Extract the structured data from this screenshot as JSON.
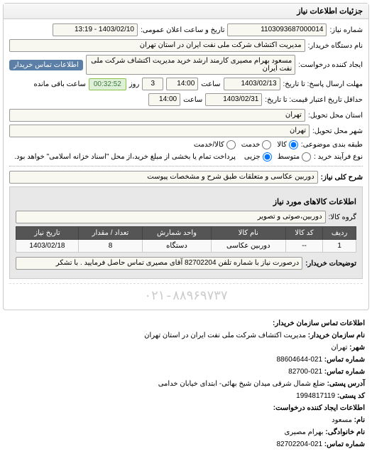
{
  "panel_title": "جزئیات اطلاعات نیاز",
  "labels": {
    "need_no": "شماره نیاز:",
    "announce_dt": "تاریخ و ساعت اعلان عمومی:",
    "buyer_name": "نام دستگاه خریدار:",
    "requester": "ایجاد کننده درخواست:",
    "buyer_contact_btn": "اطلاعات تماس خریدار",
    "reply_deadline": "مهلت ارسال پاسخ: تا تاریخ:",
    "time": "ساعت",
    "day": "روز",
    "remaining": "ساعت باقی مانده",
    "validity": "حداقل تاریخ اعتبار قیمت: تا تاریخ:",
    "province": "استان محل تحویل:",
    "city": "شهر محل تحویل:",
    "subject_type": "طبقه بندی موضوعی:",
    "purchase_type": "نوع فرآیند خرید :",
    "radio_goods": "کالا",
    "radio_service": "خدمت",
    "radio_goods_service": "کالا/خدمت",
    "radio_medium": "متوسط",
    "radio_partial": "جزیی",
    "purchase_note": "پرداخت تمام یا بخشی از مبلغ خرید،از محل \"اسناد خزانه اسلامی\" خواهد بود.",
    "overall_desc": "شرح کلی نیاز:",
    "goods_info": "اطلاعات کالاهای مورد نیاز",
    "goods_group": "گروه کالا:",
    "buyer_notes": "توضیحات خریدار:"
  },
  "values": {
    "need_no": "1103093687000014",
    "announce_dt": "1403/02/10 - 13:19",
    "buyer_name": "مدیریت اکتشاف شرکت ملی نفت ایران در استان تهران",
    "requester": "مسعود بهرام مصیری کارمند ارشد خرید مدیریت اکتشاف شرکت ملی نفت ایران",
    "reply_date": "1403/02/13",
    "reply_time": "14:00",
    "reply_days": "3",
    "countdown": "00:32:52",
    "validity_date": "1403/02/31",
    "validity_time": "14:00",
    "province": "تهران",
    "city": "تهران",
    "overall_desc": "دوربین عکاسی و متعلقات طبق شرح و مشخصات پیوست",
    "goods_group": "دوربین،صوتی و تصویر",
    "buyer_notes": "درصورت نیاز با شماره تلفن 82702204 آقای مصیری تماس حاصل فرمایید . با تشکر"
  },
  "table": {
    "headers": {
      "row": "ردیف",
      "code": "کد کالا",
      "name": "نام کالا",
      "unit": "واحد شمارش",
      "qty": "تعداد / مقدار",
      "date": "تاریخ نیاز"
    },
    "rows": [
      {
        "row": "1",
        "code": "--",
        "name": "دوربین عکاسی",
        "unit": "دستگاه",
        "qty": "8",
        "date": "1403/02/18"
      }
    ]
  },
  "watermark": "۰۲۱-۸۸۹۶۹۷۳۷",
  "contact": {
    "section": "اطلاعات تماس سازمان خریدار:",
    "org_label": "نام سازمان خریدار:",
    "org": "مدیریت اکتشاف شرکت ملی نفت ایران در استان تهران",
    "city_label": "شهر:",
    "city": "تهران",
    "tel_label": "شماره تماس:",
    "tel": "021-88604644",
    "tel2_label": "شماره تماس:",
    "tel2": "021-82700",
    "addr_label": "آدرس پستی:",
    "addr": "ضلع شمال شرقی میدان شیخ بهائی- ابتدای خیابان خدامی",
    "post_label": "کد پستی:",
    "post": "1994817119",
    "req_section": "اطلاعات ایجاد کننده درخواست:",
    "fname_label": "نام:",
    "fname": "مسعود",
    "lname_label": "نام خانوادگی:",
    "lname": "بهرام مصیری",
    "rtel_label": "شماره تماس:",
    "rtel": "021-82702204"
  }
}
